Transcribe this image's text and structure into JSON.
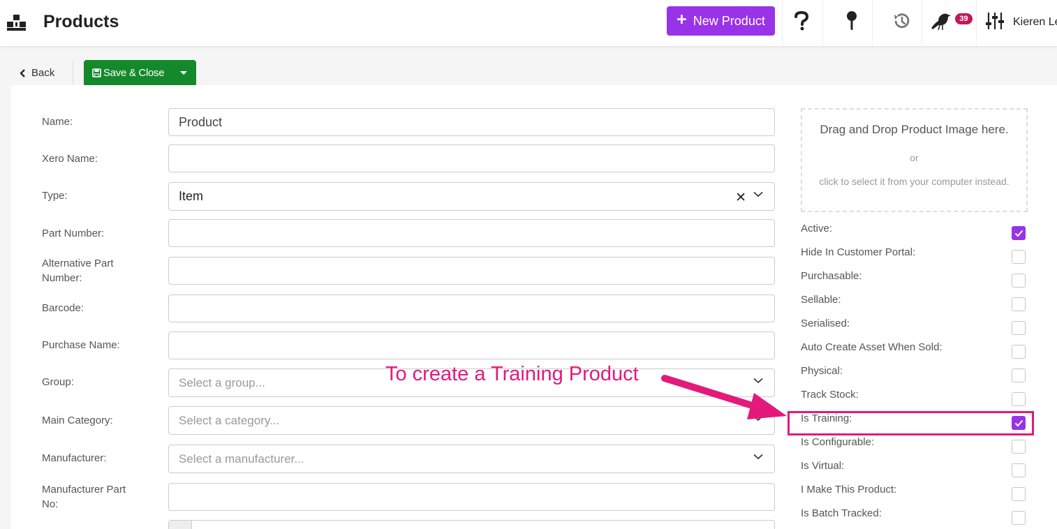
{
  "header": {
    "title": "Products",
    "new_button_label": "New Product",
    "notification_count": "39",
    "user_name": "Kieren Le"
  },
  "toolbar": {
    "back_label": "Back",
    "save_label": "Save & Close"
  },
  "form": {
    "name_label": "Name:",
    "name_value": "Product",
    "xero_label": "Xero Name:",
    "type_label": "Type:",
    "type_value": "Item",
    "part_label": "Part Number:",
    "alt_part_label_1": "Alternative Part",
    "alt_part_label_2": "Number:",
    "barcode_label": "Barcode:",
    "purchase_label": "Purchase Name:",
    "group_label": "Group:",
    "group_placeholder": "Select a group...",
    "category_label": "Main Category:",
    "category_placeholder": "Select a category...",
    "manufacturer_label": "Manufacturer:",
    "manufacturer_placeholder": "Select a manufacturer...",
    "mpn_label_1": "Manufacturer Part",
    "mpn_label_2": "No:"
  },
  "dropzone": {
    "title": "Drag and Drop Product Image here.",
    "or": "or",
    "subtitle": "click to select it from your computer instead."
  },
  "checkboxes": [
    {
      "label": "Active:",
      "checked": true
    },
    {
      "label": "Hide In Customer Portal:",
      "checked": false
    },
    {
      "label": "Purchasable:",
      "checked": false
    },
    {
      "label": "Sellable:",
      "checked": false
    },
    {
      "label": "Serialised:",
      "checked": false
    },
    {
      "label": "Auto Create Asset When Sold:",
      "checked": false
    },
    {
      "label": "Physical:",
      "checked": false
    },
    {
      "label": "Track Stock:",
      "checked": false
    },
    {
      "label": "Is Training:",
      "checked": true
    },
    {
      "label": "Is Configurable:",
      "checked": false
    },
    {
      "label": "Is Virtual:",
      "checked": false
    },
    {
      "label": "I Make This Product:",
      "checked": false
    },
    {
      "label": "Is Batch Tracked:",
      "checked": false
    }
  ],
  "annotation": {
    "text": "To create a Training Product",
    "color": "#e3197b"
  },
  "colors": {
    "accent": "#9933e8",
    "save": "#13892b",
    "badge": "#c2185b"
  },
  "icons": {
    "logo": "boxes-logo-icon",
    "help": "question-mark-icon",
    "pin": "map-pin-icon",
    "history": "history-icon",
    "notifications": "bird-icon",
    "settings": "sliders-icon",
    "back": "chevron-left-icon",
    "save": "floppy-disk-icon"
  }
}
